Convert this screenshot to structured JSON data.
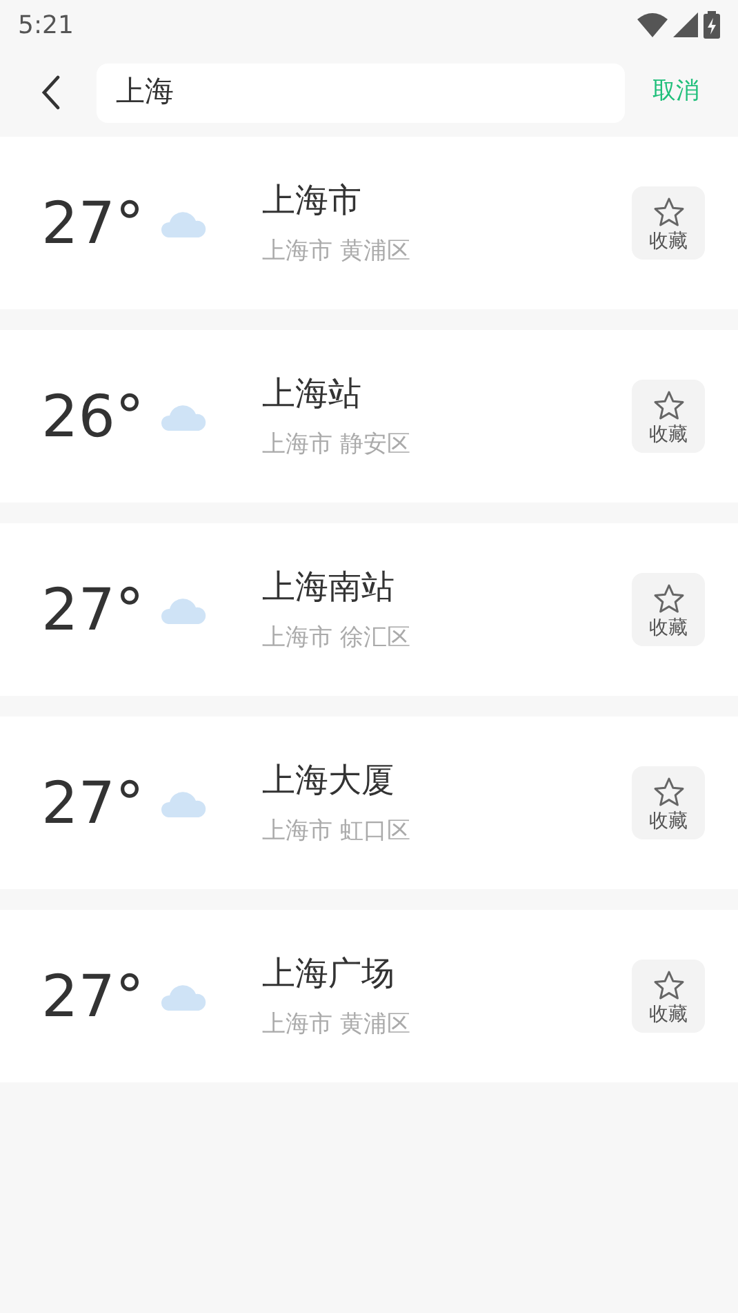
{
  "status_bar": {
    "time": "5:21"
  },
  "search": {
    "value": "上海",
    "cancel": "取消"
  },
  "results": [
    {
      "temp": "27°",
      "kind": "cloudy",
      "name": "上海市",
      "region": "上海市 黄浦区",
      "fav_label": "收藏",
      "favorited": false
    },
    {
      "temp": "26°",
      "kind": "cloudy",
      "name": "上海站",
      "region": "上海市 静安区",
      "fav_label": "收藏",
      "favorited": false
    },
    {
      "temp": "27°",
      "kind": "cloudy",
      "name": "上海南站",
      "region": "上海市 徐汇区",
      "fav_label": "收藏",
      "favorited": false
    },
    {
      "temp": "27°",
      "kind": "cloudy",
      "name": "上海大厦",
      "region": "上海市 虹口区",
      "fav_label": "收藏",
      "favorited": false
    },
    {
      "temp": "27°",
      "kind": "cloudy",
      "name": "上海广场",
      "region": "上海市 黄浦区",
      "fav_label": "收藏",
      "favorited": false
    }
  ]
}
